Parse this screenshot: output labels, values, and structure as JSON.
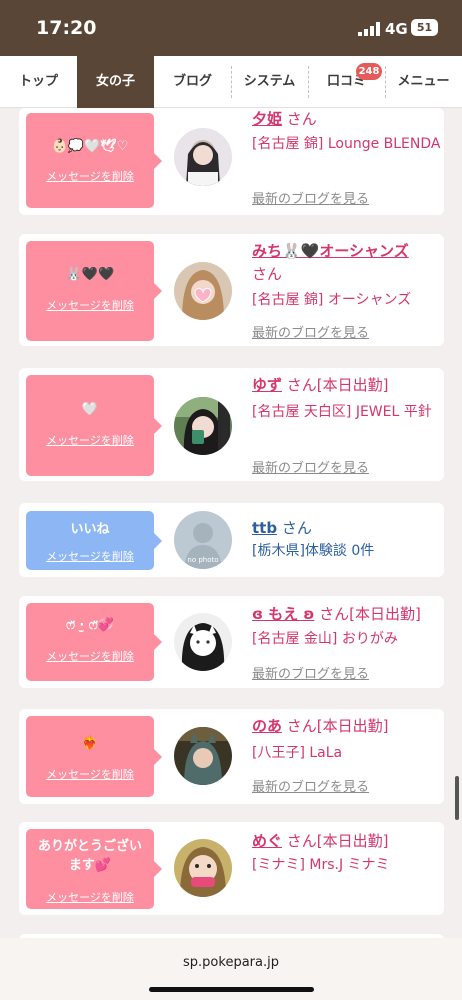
{
  "status": {
    "time": "17:20",
    "network": "4G",
    "battery": "51"
  },
  "nav": {
    "tabs": [
      {
        "label": "トップ"
      },
      {
        "label": "女の子"
      },
      {
        "label": "ブログ"
      },
      {
        "label": "システム"
      },
      {
        "label": "口コミ",
        "badge": "248"
      },
      {
        "label": "メニュー"
      }
    ],
    "active": "女の子"
  },
  "cards": [
    {
      "msg": "👶🏻💭🤍🕊♡",
      "delete": "メッセージを削除",
      "name": "夕姫",
      "suffix": "さん",
      "shop": "[名古屋 錦] Lounge BLENDA",
      "blog": "最新のブログを見る"
    },
    {
      "msg": "🐰🖤🖤",
      "delete": "メッセージを削除",
      "name": "みち🐰🖤オーシャンズ",
      "suffix": "さん",
      "shop": "[名古屋 錦] オーシャンズ",
      "blog": "最新のブログを見る"
    },
    {
      "msg": "🤍",
      "delete": "メッセージを削除",
      "name": "ゆず",
      "suffix": "さん[本日出勤]",
      "shop": "[名古屋 天白区] JEWEL 平針",
      "blog": "最新のブログを見る"
    },
    {
      "msg": "いいね",
      "delete": "メッセージを削除",
      "name": "ttb",
      "suffix": "さん",
      "shop": "[栃木県]体験談 0件",
      "avatar_text": "no photo"
    },
    {
      "msg": "ෆ̈ ·̫ ෆ̈💞",
      "delete": "メッセージを削除",
      "name": "ɞ もえ ʚ",
      "suffix": "さん[本日出勤]",
      "shop": "[名古屋 金山] おりがみ",
      "blog": "最新のブログを見る"
    },
    {
      "msg": "❤️‍🔥",
      "delete": "メッセージを削除",
      "name": "のあ",
      "suffix": "さん[本日出勤]",
      "shop": "[八王子] LaLa",
      "blog": "最新のブログを見る"
    },
    {
      "msg": "ありがとうございます💕",
      "delete": "メッセージを削除",
      "name": "めぐ",
      "suffix": "さん[本日出勤]",
      "shop": "[ミナミ] Mrs.J ミナミ"
    }
  ],
  "browser": {
    "url": "sp.pokepara.jp"
  },
  "colors": {
    "brown": "#5a4636",
    "pink": "#fd8fa0",
    "blue_bubble": "#8cb6f4",
    "name_pink": "#d6356e",
    "link_blue": "#2c5f9e"
  }
}
